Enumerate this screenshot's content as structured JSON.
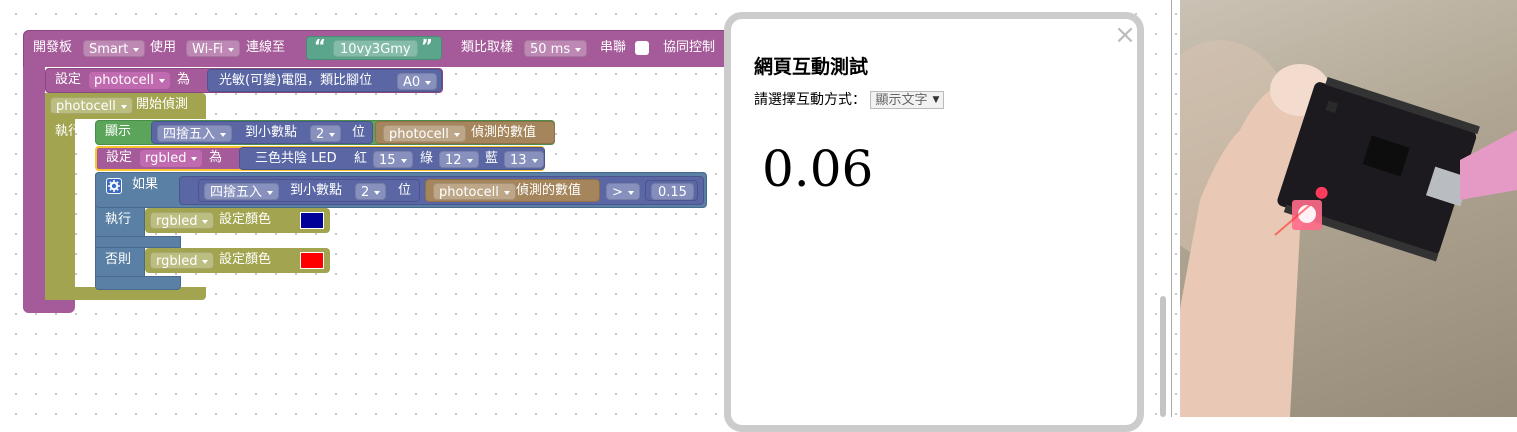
{
  "workspace": {
    "main": {
      "label_board": "開發板",
      "board_type": "Smart",
      "label_use": "使用",
      "conn_type": "Wi-Fi",
      "label_connect": "連線至",
      "quote_open": "“",
      "device_id": "10vy3Gmy",
      "quote_close": "”",
      "label_sampling": "類比取樣",
      "sampling": "50 ms",
      "label_serial": "串聯",
      "label_coop": "協同控制"
    },
    "set_photocell": {
      "label_set": "設定",
      "var": "photocell",
      "label_as": "為",
      "label_sensor": "光敏(可變)電阻，類比腳位",
      "pin": "A0"
    },
    "start_detect": {
      "var": "photocell",
      "label": "開始偵測"
    },
    "label_exec": "執行",
    "show": {
      "label": "顯示",
      "round": "四捨五入",
      "label_to": "到小數點",
      "digits": "2",
      "label_pos": "位",
      "var": "photocell",
      "label_value": "偵測的數值"
    },
    "set_led": {
      "label_set": "設定",
      "var": "rgbled",
      "label_as": "為",
      "label_led": "三色共陰 LED",
      "label_red": "紅",
      "red_pin": "15",
      "label_green": "綠",
      "green_pin": "12",
      "label_blue": "藍",
      "blue_pin": "13"
    },
    "if_block": {
      "label_if": "如果",
      "round": "四捨五入",
      "label_to": "到小數點",
      "digits": "2",
      "label_pos": "位",
      "var": "photocell",
      "label_value": "偵測的數值",
      "op": ">",
      "threshold": "0.15",
      "label_then": "執行",
      "then_var": "rgbled",
      "then_action": "設定顏色",
      "then_color": "#000099",
      "label_else": "否則",
      "else_var": "rgbled",
      "else_action": "設定顏色",
      "else_color": "#ff0000"
    }
  },
  "panel": {
    "close": "×",
    "title": "網頁互動測試",
    "select_label": "請選擇互動方式：",
    "select_value": "顯示文字",
    "display_value": "0.06"
  },
  "colors": {
    "purple": "#a55b99",
    "olive": "#a3a44f",
    "green": "#5ba55b",
    "blue": "#5b80a5",
    "brown": "#a5855b",
    "teal": "#5ba58c",
    "indigo": "#5b67a5"
  }
}
